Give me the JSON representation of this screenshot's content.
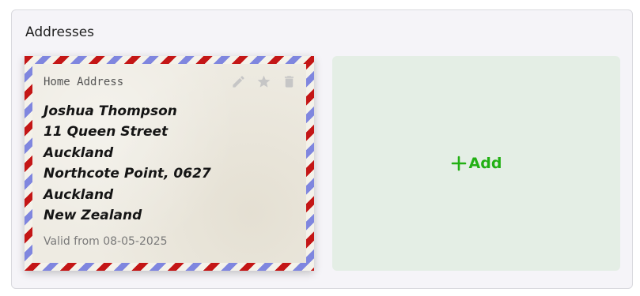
{
  "section": {
    "title": "Addresses"
  },
  "address_card": {
    "label": "Home Address",
    "lines": [
      "Joshua Thompson",
      "11 Queen Street",
      "Auckland",
      "Northcote Point, 0627",
      "Auckland",
      "New Zealand"
    ],
    "valid_from": "Valid from 08-05-2025",
    "actions": [
      {
        "icon": "pencil-icon",
        "action": "edit"
      },
      {
        "icon": "star-icon",
        "action": "set-default"
      },
      {
        "icon": "trash-icon",
        "action": "delete"
      }
    ],
    "border_colors": {
      "red": "#c41616",
      "blue": "#7f86df"
    }
  },
  "add_tile": {
    "label": "Add",
    "icon": "plus-icon",
    "accent": "#22b014",
    "background": "#e4eee5"
  }
}
